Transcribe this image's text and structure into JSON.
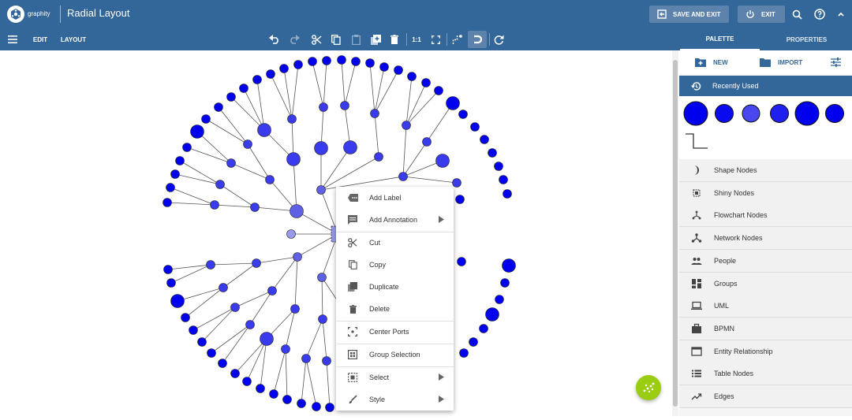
{
  "header": {
    "brand": "graphity",
    "title": "Radial Layout",
    "save_exit": "SAVE AND EXIT",
    "exit": "EXIT"
  },
  "toolbar": {
    "edit": "EDIT",
    "layout": "LAYOUT",
    "zoom_reset": "1:1"
  },
  "tabs": {
    "palette": "PALETTE",
    "properties": "PROPERTIES"
  },
  "palette": {
    "new": "NEW",
    "import": "IMPORT",
    "recent": "Recently Used",
    "sections": [
      {
        "label": "Shape Nodes",
        "icon": "half-moon-icon"
      },
      {
        "label": "Shiny Nodes",
        "icon": "shiny-icon"
      },
      {
        "label": "Flowchart Nodes",
        "icon": "flowchart-icon"
      },
      {
        "label": "Network Nodes",
        "icon": "network-icon"
      },
      {
        "label": "People",
        "icon": "people-icon"
      },
      {
        "label": "Groups",
        "icon": "groups-icon"
      },
      {
        "label": "UML",
        "icon": "laptop-icon"
      },
      {
        "label": "BPMN",
        "icon": "briefcase-icon"
      },
      {
        "label": "Entity Relationship",
        "icon": "window-icon"
      },
      {
        "label": "Table Nodes",
        "icon": "list-icon"
      },
      {
        "label": "Edges",
        "icon": "trend-icon"
      }
    ]
  },
  "context_menu": {
    "add_label": "Add Label",
    "add_annotation": "Add Annotation",
    "cut": "Cut",
    "copy": "Copy",
    "duplicate": "Duplicate",
    "delete": "Delete",
    "center_ports": "Center Ports",
    "group_selection": "Group Selection",
    "select": "Select",
    "style": "Style"
  },
  "colors": {
    "header": "#336699",
    "outer_node": "#0000ee",
    "mid_node": "#3b3bee",
    "inner_node": "#6060e6",
    "center_node": "#9999ee",
    "fab": "#9acd12"
  }
}
